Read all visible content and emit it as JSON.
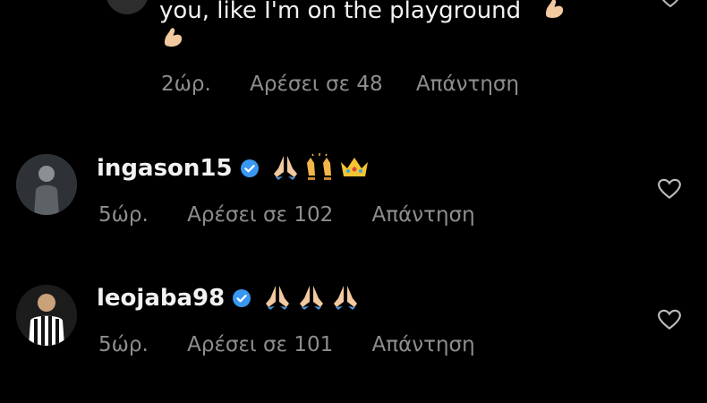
{
  "top_comment": {
    "text": "you, like I'm on the playground",
    "emoji": "flexed-biceps",
    "time": "2ώρ.",
    "likes": "Αρέσει σε 48",
    "reply": "Απάντηση"
  },
  "comments": [
    {
      "username": "ingason15",
      "verified": true,
      "emojis": [
        "folded-hands",
        "raising-hands",
        "crown"
      ],
      "time": "5ώρ.",
      "likes": "Αρέσει σε 102",
      "reply": "Απάντηση"
    },
    {
      "username": "leojaba98",
      "verified": true,
      "emojis": [
        "folded-hands",
        "folded-hands",
        "folded-hands"
      ],
      "time": "5ώρ.",
      "likes": "Αρέσει σε 101",
      "reply": "Απάντηση"
    }
  ],
  "colors": {
    "background": "#000000",
    "primary_text": "#f2f2f2",
    "secondary_text": "#8e8e8e",
    "verified_badge": "#3897f0"
  }
}
